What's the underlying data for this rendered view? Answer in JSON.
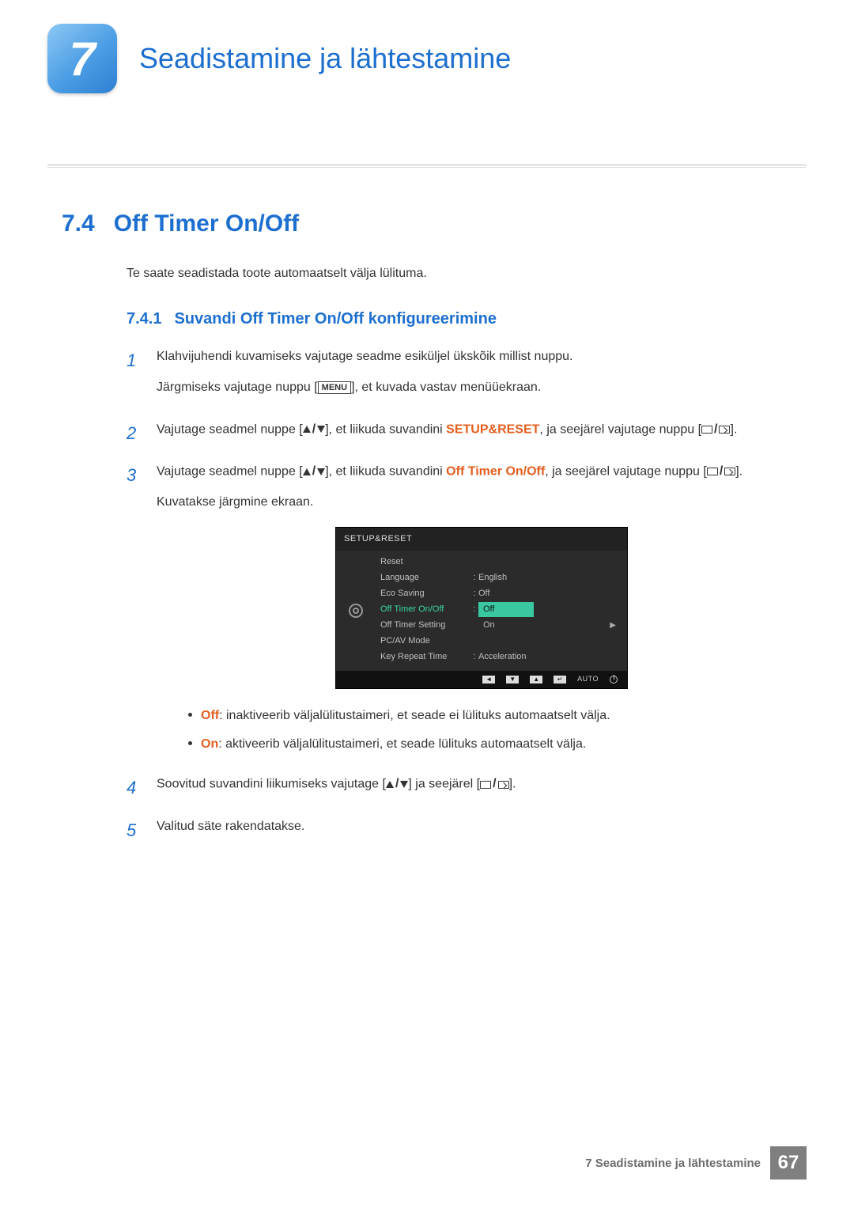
{
  "header": {
    "chapter_number": "7",
    "chapter_title": "Seadistamine ja lähtestamine"
  },
  "section": {
    "number": "7.4",
    "title": "Off Timer On/Off",
    "intro": "Te saate seadistada toote automaatselt välja lülituma."
  },
  "subsection": {
    "number": "7.4.1",
    "title": "Suvandi Off Timer On/Off konfigureerimine"
  },
  "steps": {
    "s1": {
      "num": "1",
      "p1": "Klahvijuhendi kuvamiseks vajutage seadme esiküljel ükskõik millist nuppu.",
      "p2a": "Järgmiseks vajutage nuppu [",
      "menu_label": "MENU",
      "p2b": "], et kuvada vastav menüüekraan."
    },
    "s2": {
      "num": "2",
      "a": "Vajutage seadmel nuppe [",
      "b": "], et liikuda suvandini ",
      "hl": "SETUP&RESET",
      "c": ", ja seejärel vajutage nuppu [",
      "d": "]."
    },
    "s3": {
      "num": "3",
      "a": "Vajutage seadmel nuppe [",
      "b": "], et liikuda suvandini ",
      "hl": "Off Timer On/Off",
      "c": ", ja seejärel vajutage nuppu [",
      "d": "].",
      "e": "Kuvatakse järgmine ekraan."
    },
    "bullets": {
      "off_label": "Off",
      "off_text": ": inaktiveerib väljalülitustaimeri, et seade ei lülituks automaatselt välja.",
      "on_label": "On",
      "on_text": ": aktiveerib väljalülitustaimeri, et seade lülituks automaatselt välja."
    },
    "s4": {
      "num": "4",
      "a": "Soovitud suvandini liikumiseks vajutage [",
      "b": "] ja seejärel [",
      "c": "]."
    },
    "s5": {
      "num": "5",
      "text": "Valitud säte rakendatakse."
    }
  },
  "osd": {
    "title": "SETUP&RESET",
    "items": {
      "reset": "Reset",
      "language": "Language",
      "language_val": "English",
      "eco": "Eco Saving",
      "eco_val": "Off",
      "timer_onoff": "Off Timer On/Off",
      "timer_setting": "Off Timer Setting",
      "pcav": "PC/AV Mode",
      "keyrepeat": "Key Repeat Time",
      "keyrepeat_val": "Acceleration"
    },
    "options": {
      "off": "Off",
      "on": "On"
    },
    "footer": {
      "auto": "AUTO"
    }
  },
  "footer": {
    "text": "7 Seadistamine ja lähtestamine",
    "page": "67"
  }
}
